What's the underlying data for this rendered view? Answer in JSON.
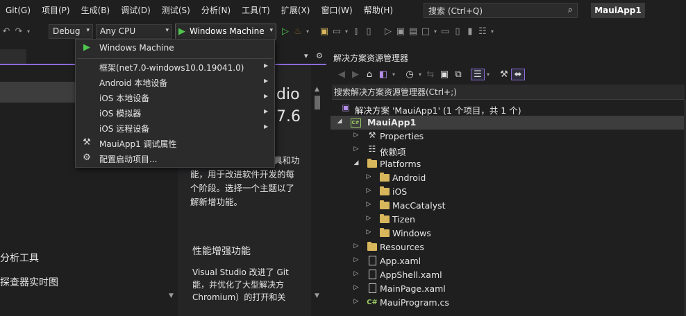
{
  "menubar": {
    "items": [
      "Git(G)",
      "项目(P)",
      "生成(B)",
      "调试(D)",
      "测试(S)",
      "分析(N)",
      "工具(T)",
      "扩展(X)",
      "窗口(W)",
      "帮助(H)"
    ],
    "search_label": "搜索 (Ctrl+Q)",
    "app_title": "MauiApp1"
  },
  "toolbar": {
    "config": "Debug",
    "platform": "Any CPU",
    "run_target": "Windows Machine"
  },
  "dropdown": {
    "items": [
      {
        "label": "Windows Machine",
        "icon": "play-icon",
        "submenu": false
      },
      {
        "label": "框架(net7.0-windows10.0.19041.0)",
        "icon": "",
        "submenu": true
      },
      {
        "label": "Android 本地设备",
        "icon": "",
        "submenu": true
      },
      {
        "label": "iOS 本地设备",
        "icon": "",
        "submenu": true
      },
      {
        "label": "iOS 模拟器",
        "icon": "",
        "submenu": true
      },
      {
        "label": "iOS 远程设备",
        "icon": "",
        "submenu": true
      },
      {
        "label": "MauiApp1 调试属性",
        "icon": "wrench-icon",
        "submenu": false
      },
      {
        "label": "配置启动项目...",
        "icon": "gear-icon",
        "submenu": false
      }
    ]
  },
  "whats_new": {
    "title_line1": "dio",
    "title_line2": "7.6",
    "para1": [
      "具和功",
      "能，用于改进软件开发的每",
      "个阶段。选择一个主题以了",
      "解新增功能。"
    ],
    "heading2": "性能增强功能",
    "para2": [
      "Visual Studio 改进了 Git",
      "能，并优化了大型解决方",
      "Chromium）的打开和关"
    ]
  },
  "left_pane": {
    "line1": "分析工具",
    "line2": "探查器实时图"
  },
  "solution_explorer": {
    "title": "解决方案资源管理器",
    "search_placeholder": "搜索解决方案资源管理器(Ctrl+;)",
    "tree": [
      {
        "label": "解决方案 'MauiApp1' (1 个项目，共 1 个)",
        "level": 0,
        "type": "solution",
        "expander": "",
        "bold": false
      },
      {
        "label": "MauiApp1",
        "level": 0,
        "type": "csproj",
        "expander": "◢",
        "bold": true,
        "selected": true
      },
      {
        "label": "Properties",
        "level": 1,
        "type": "properties",
        "expander": "▷"
      },
      {
        "label": "依赖项",
        "level": 1,
        "type": "deps",
        "expander": "▷"
      },
      {
        "label": "Platforms",
        "level": 1,
        "type": "folder-open",
        "expander": "◢"
      },
      {
        "label": "Android",
        "level": 2,
        "type": "folder",
        "expander": "▷"
      },
      {
        "label": "iOS",
        "level": 2,
        "type": "folder",
        "expander": "▷"
      },
      {
        "label": "MacCatalyst",
        "level": 2,
        "type": "folder",
        "expander": "▷"
      },
      {
        "label": "Tizen",
        "level": 2,
        "type": "folder",
        "expander": "▷"
      },
      {
        "label": "Windows",
        "level": 2,
        "type": "folder",
        "expander": "▷"
      },
      {
        "label": "Resources",
        "level": 1,
        "type": "folder",
        "expander": "▷"
      },
      {
        "label": "App.xaml",
        "level": 1,
        "type": "xaml",
        "expander": "▷"
      },
      {
        "label": "AppShell.xaml",
        "level": 1,
        "type": "xaml",
        "expander": "▷"
      },
      {
        "label": "MainPage.xaml",
        "level": 1,
        "type": "xaml",
        "expander": "▷"
      },
      {
        "label": "MauiProgram.cs",
        "level": 1,
        "type": "cs",
        "expander": "▷"
      }
    ]
  },
  "colors": {
    "accent": "#8b6bd8",
    "run_green": "#4ec64e",
    "folder": "#d8b65c",
    "background": "#1f1f1f"
  }
}
